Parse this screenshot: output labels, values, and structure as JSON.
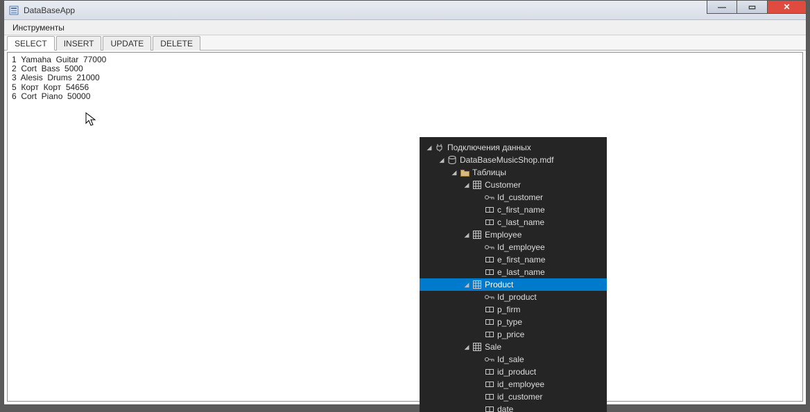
{
  "window": {
    "title": "DataBaseApp",
    "buttons": {
      "min": "—",
      "max": "▭",
      "close": "✕"
    }
  },
  "menu": {
    "tools": "Инструменты"
  },
  "tabs": [
    {
      "label": "SELECT",
      "active": true
    },
    {
      "label": "INSERT",
      "active": false
    },
    {
      "label": "UPDATE",
      "active": false
    },
    {
      "label": "DELETE",
      "active": false
    }
  ],
  "rows": [
    "1  Yamaha  Guitar  77000",
    "2  Cort  Bass  5000",
    "3  Alesis  Drums  21000",
    "5  Корт  Корт  54656",
    "6  Cort  Piano  50000"
  ],
  "tree": [
    {
      "depth": 0,
      "expander": "◢",
      "icon": "plug",
      "label": "Подключения данных"
    },
    {
      "depth": 1,
      "expander": "◢",
      "icon": "db",
      "label": "DataBaseMusicShop.mdf"
    },
    {
      "depth": 2,
      "expander": "◢",
      "icon": "folder",
      "label": "Таблицы"
    },
    {
      "depth": 3,
      "expander": "◢",
      "icon": "table",
      "label": "Customer"
    },
    {
      "depth": 4,
      "expander": "",
      "icon": "key",
      "label": "Id_customer"
    },
    {
      "depth": 4,
      "expander": "",
      "icon": "col",
      "label": "c_first_name"
    },
    {
      "depth": 4,
      "expander": "",
      "icon": "col",
      "label": "c_last_name"
    },
    {
      "depth": 3,
      "expander": "◢",
      "icon": "table",
      "label": "Employee"
    },
    {
      "depth": 4,
      "expander": "",
      "icon": "key",
      "label": "Id_employee"
    },
    {
      "depth": 4,
      "expander": "",
      "icon": "col",
      "label": "e_first_name"
    },
    {
      "depth": 4,
      "expander": "",
      "icon": "col",
      "label": "e_last_name"
    },
    {
      "depth": 3,
      "expander": "◢",
      "icon": "table",
      "label": "Product",
      "selected": true
    },
    {
      "depth": 4,
      "expander": "",
      "icon": "key",
      "label": "Id_product"
    },
    {
      "depth": 4,
      "expander": "",
      "icon": "col",
      "label": "p_firm"
    },
    {
      "depth": 4,
      "expander": "",
      "icon": "col",
      "label": "p_type"
    },
    {
      "depth": 4,
      "expander": "",
      "icon": "col",
      "label": "p_price"
    },
    {
      "depth": 3,
      "expander": "◢",
      "icon": "table",
      "label": "Sale"
    },
    {
      "depth": 4,
      "expander": "",
      "icon": "key",
      "label": "Id_sale"
    },
    {
      "depth": 4,
      "expander": "",
      "icon": "col",
      "label": "id_product"
    },
    {
      "depth": 4,
      "expander": "",
      "icon": "col",
      "label": "id_employee"
    },
    {
      "depth": 4,
      "expander": "",
      "icon": "col",
      "label": "id_customer"
    },
    {
      "depth": 4,
      "expander": "",
      "icon": "col",
      "label": "date"
    }
  ],
  "icons": {
    "plug": "🔌",
    "db": "🗄",
    "folder": "📁",
    "table": "⊞",
    "key": "⚿",
    "col": "▭"
  }
}
